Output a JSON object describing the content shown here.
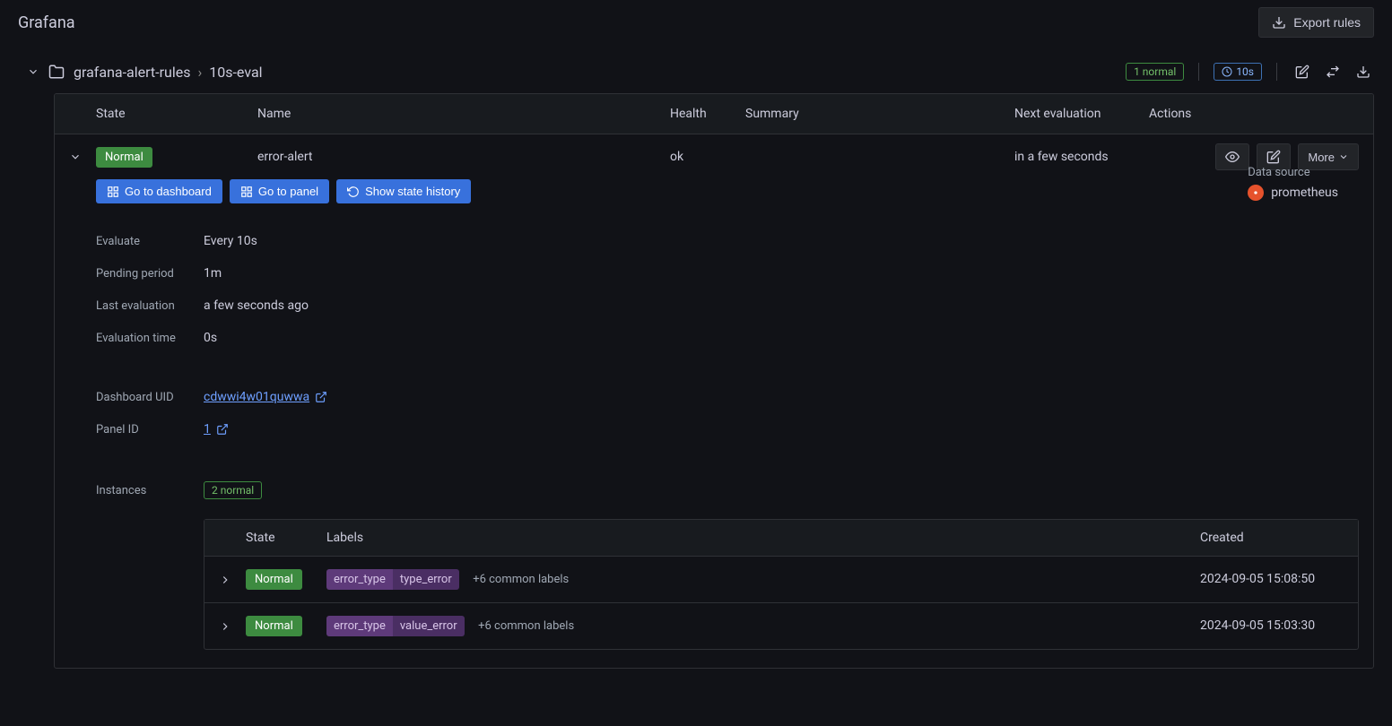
{
  "brand": "Grafana",
  "export_rules_label": "Export rules",
  "breadcrumb": {
    "folder": "grafana-alert-rules",
    "group": "10s-eval"
  },
  "header_badges": {
    "normal": "1 normal",
    "interval": "10s"
  },
  "table": {
    "headers": {
      "state": "State",
      "name": "Name",
      "health": "Health",
      "summary": "Summary",
      "next_eval": "Next evaluation",
      "actions": "Actions"
    },
    "row": {
      "state": "Normal",
      "name": "error-alert",
      "health": "ok",
      "summary": "",
      "next_eval": "in a few seconds",
      "more_label": "More"
    }
  },
  "action_buttons": {
    "go_dashboard": "Go to dashboard",
    "go_panel": "Go to panel",
    "show_history": "Show state history"
  },
  "details": {
    "evaluate_label": "Evaluate",
    "evaluate_value": "Every 10s",
    "pending_label": "Pending period",
    "pending_value": "1m",
    "last_eval_label": "Last evaluation",
    "last_eval_value": "a few seconds ago",
    "eval_time_label": "Evaluation time",
    "eval_time_value": "0s",
    "dashboard_uid_label": "Dashboard UID",
    "dashboard_uid_value": "cdwwi4w01quwwa",
    "panel_id_label": "Panel ID",
    "panel_id_value": "1",
    "data_source_label": "Data source",
    "data_source_value": "prometheus"
  },
  "instances": {
    "label": "Instances",
    "badge": "2 normal",
    "headers": {
      "state": "State",
      "labels": "Labels",
      "created": "Created"
    },
    "rows": [
      {
        "state": "Normal",
        "label_key": "error_type",
        "label_value": "type_error",
        "common": "+6 common labels",
        "created": "2024-09-05 15:08:50"
      },
      {
        "state": "Normal",
        "label_key": "error_type",
        "label_value": "value_error",
        "common": "+6 common labels",
        "created": "2024-09-05 15:03:30"
      }
    ]
  }
}
